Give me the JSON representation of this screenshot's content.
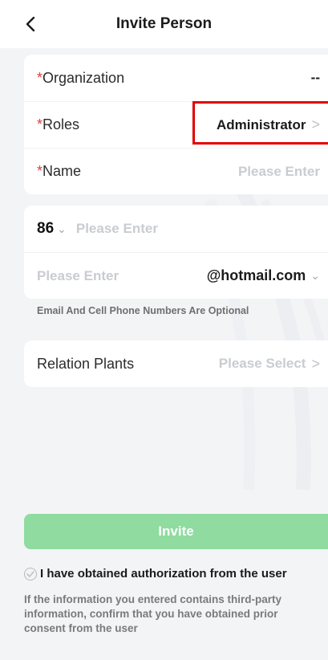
{
  "header": {
    "title": "Invite Person",
    "back_icon": "chevron-left-icon"
  },
  "form": {
    "organization": {
      "required_mark": "*",
      "label": "Organization",
      "value": "--"
    },
    "roles": {
      "required_mark": "*",
      "label": "Roles",
      "value": "Administrator",
      "chevron": ">"
    },
    "name": {
      "required_mark": "*",
      "label": "Name",
      "placeholder": "Please Enter"
    }
  },
  "contact": {
    "country_code": "86",
    "cc_chevron": "⌄",
    "phone_placeholder": "Please Enter",
    "email_placeholder": "Please Enter",
    "email_domain": "@hotmail.com",
    "domain_chevron": "⌄"
  },
  "note": "Email And Cell Phone Numbers Are Optional",
  "relation": {
    "label": "Relation Plants",
    "placeholder": "Please Select",
    "chevron": ">"
  },
  "invite_button": "Invite",
  "consent": {
    "label": "I have obtained authorization from the user",
    "disclaimer": "If the information you entered contains third-party information, confirm that you have obtained prior consent from the user"
  },
  "colors": {
    "accent_green": "#8fdba0",
    "required_red": "#e23b3b",
    "highlight_red": "#e10000",
    "placeholder": "#c9ccd1",
    "background": "#f3f4f6"
  }
}
